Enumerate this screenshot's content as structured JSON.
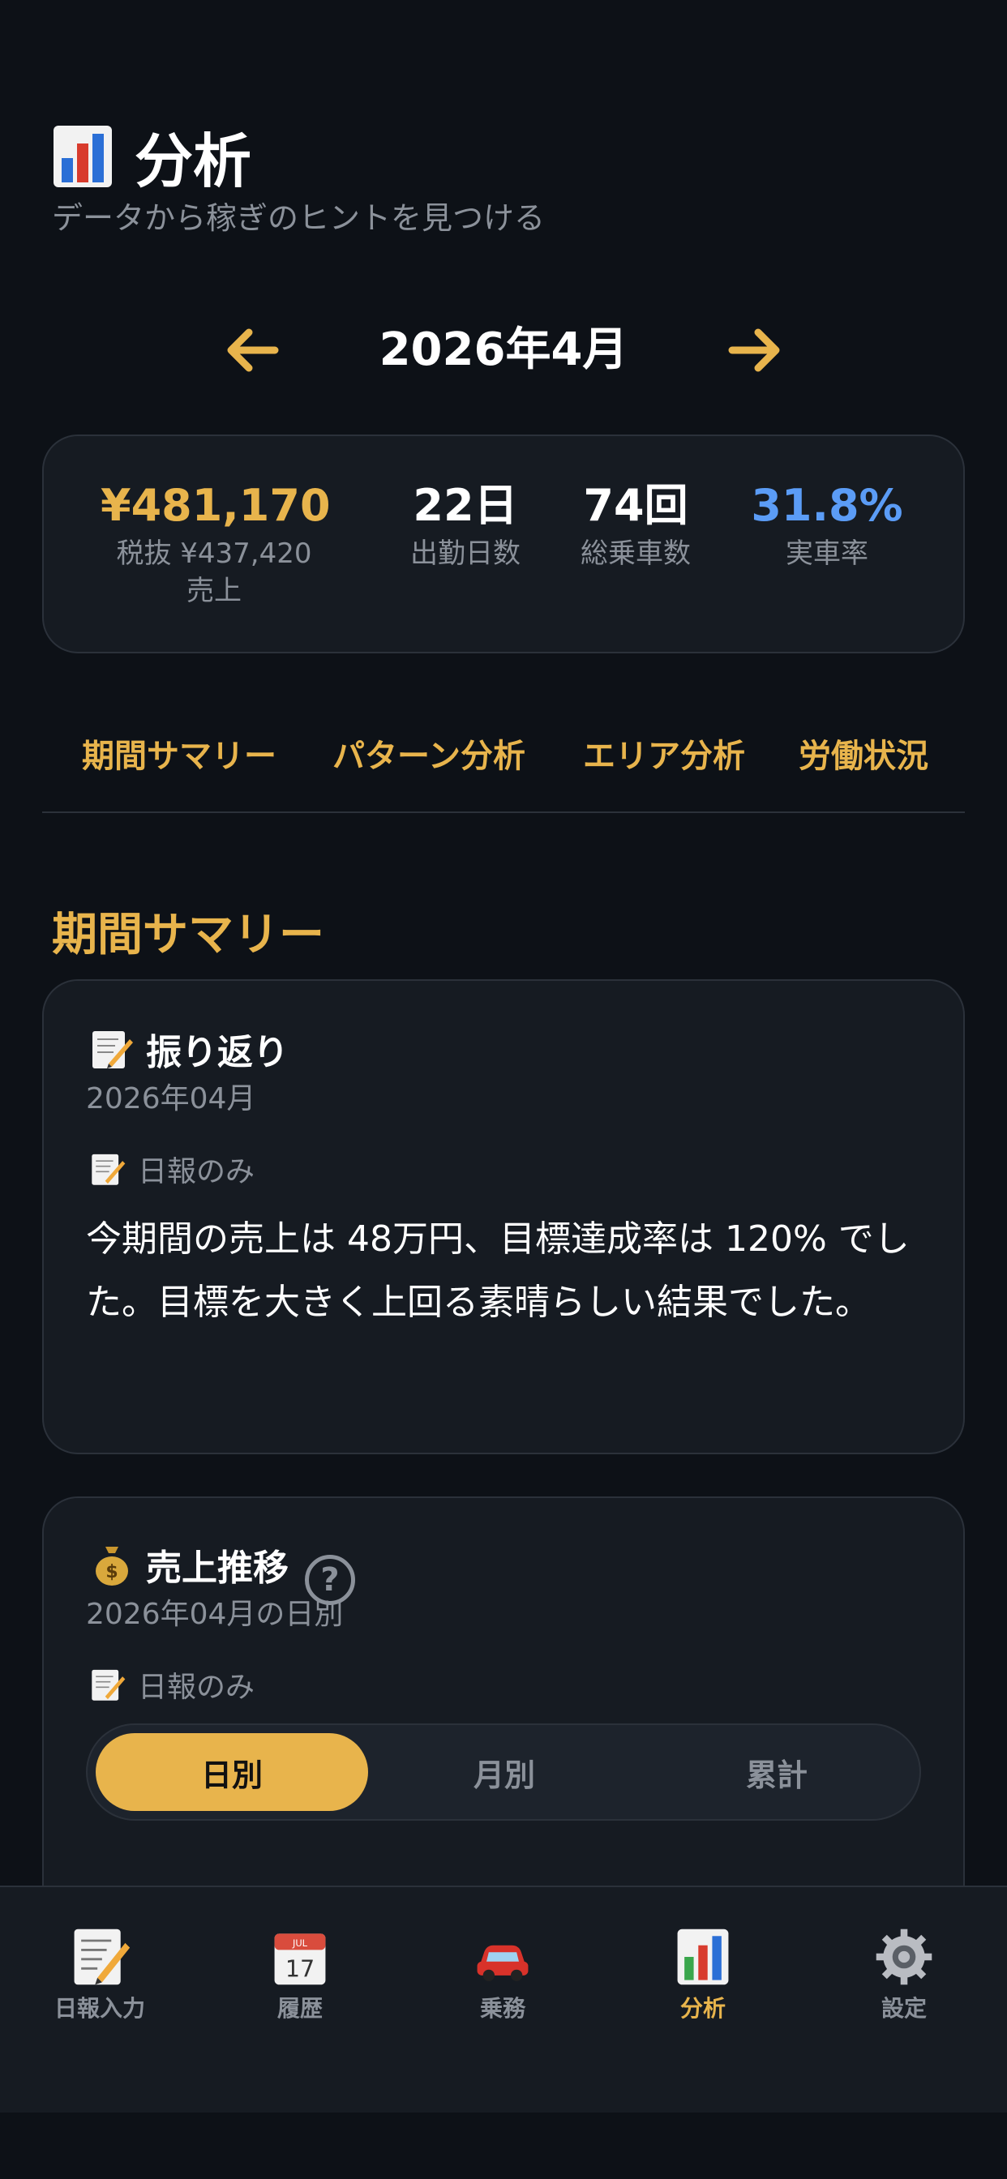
{
  "header": {
    "title": "分析",
    "subtitle": "データから稼ぎのヒントを見つける",
    "icon": "bar-chart-icon"
  },
  "month_nav": {
    "label": "2026年4月",
    "prev_icon": "arrow-left-icon",
    "next_icon": "arrow-right-icon"
  },
  "stats": {
    "sales_value": "¥481,170",
    "sales_tax_excluded": "税抜 ¥437,420",
    "sales_label": "売上",
    "days_value": "22日",
    "days_label": "出勤日数",
    "rides_value": "74回",
    "rides_label": "総乗車数",
    "rate_value": "31.8%",
    "rate_label": "実車率"
  },
  "tabs": [
    "期間サマリー",
    "パターン分析",
    "エリア分析",
    "労働状況"
  ],
  "section_title": "期間サマリー",
  "review_card": {
    "title": "振り返り",
    "date": "2026年04月",
    "source": "日報のみ",
    "body": "今期間の売上は 48万円、目標達成率は 120% でした。目標を大きく上回る素晴らしい結果でした。"
  },
  "sales_card": {
    "title": "売上推移",
    "date": "2026年04月の日別",
    "source": "日報のみ",
    "help": "?",
    "segments": [
      "日別",
      "月別",
      "累計"
    ],
    "active_segment": "日別"
  },
  "tabbar": [
    {
      "label": "日報入力",
      "icon": "memo-icon"
    },
    {
      "label": "履歴",
      "icon": "calendar-icon"
    },
    {
      "label": "乗務",
      "icon": "car-icon"
    },
    {
      "label": "分析",
      "icon": "bar-chart-icon",
      "active": true
    },
    {
      "label": "設定",
      "icon": "gear-icon"
    }
  ],
  "colors": {
    "background": "#0d1117",
    "card": "#161b22",
    "accent": "#e8b44c",
    "blue": "#5b9cf6",
    "muted": "#8b919a"
  }
}
